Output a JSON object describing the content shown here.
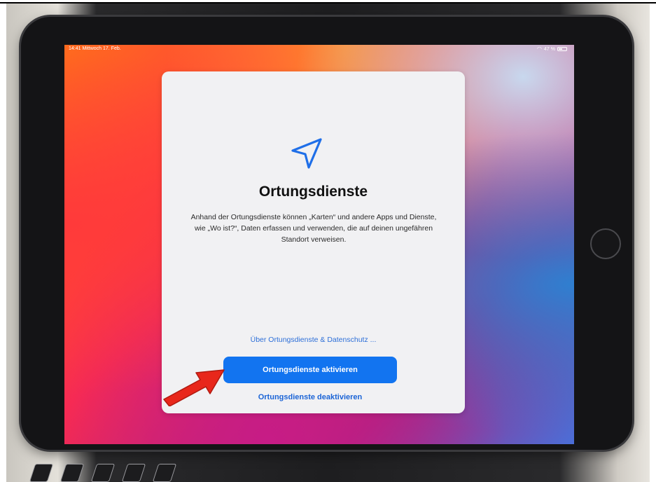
{
  "status_bar": {
    "time_date": "14:41  Mittwoch 17. Feb.",
    "battery": "47 %"
  },
  "sheet": {
    "icon": "location-arrow-icon",
    "title": "Ortungsdienste",
    "description": "Anhand der Ortungsdienste können „Karten“ und andere Apps und Dienste, wie „Wo ist?“, Daten erfassen und verwenden, die auf deinen ungefähren Standort verweisen.",
    "privacy_link": "Über Ortungsdienste & Datenschutz ...",
    "primary_button": "Ortungsdienste aktivieren",
    "secondary_button": "Ortungsdienste deaktivieren"
  },
  "annotation": {
    "icon": "red-pointer-arrow-icon",
    "color": "#e8271b"
  },
  "colors": {
    "accent": "#1274f0",
    "link": "#2d6fd8"
  }
}
